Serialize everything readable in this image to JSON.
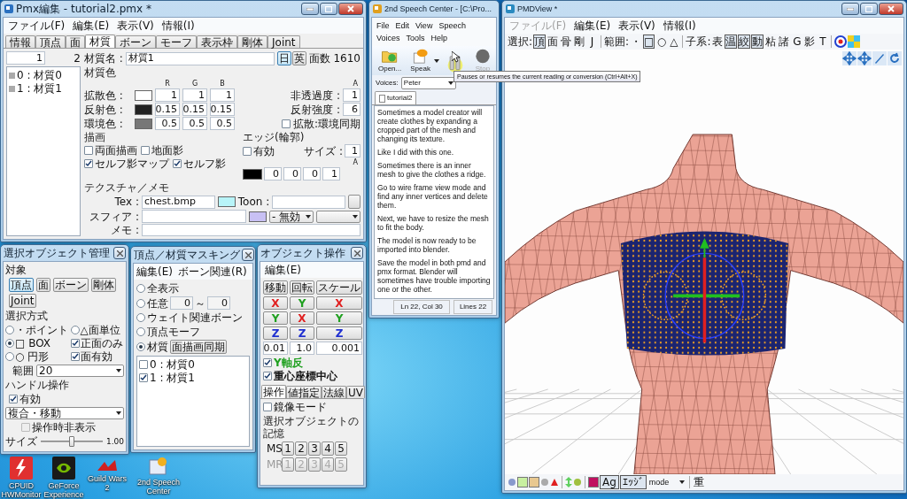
{
  "desktop": {
    "icons": [
      {
        "label": "CPUID HWMonitor",
        "kind": "cpuid"
      },
      {
        "label": "GeForce Experience",
        "kind": "geforce"
      },
      {
        "label": "Guild Wars 2",
        "kind": "game"
      },
      {
        "label": "2nd Speech Center",
        "kind": "speech"
      }
    ]
  },
  "pmx_editor": {
    "title": "Pmx編集 - tutorial2.pmx *",
    "menu": [
      "ファイル(F)",
      "編集(E)",
      "表示(V)",
      "情報(I)"
    ],
    "tabs": [
      {
        "label": "情報",
        "selected": false
      },
      {
        "label": "頂点",
        "selected": false
      },
      {
        "label": "面",
        "selected": false
      },
      {
        "label": "材質",
        "selected": true
      },
      {
        "label": "ボーン",
        "selected": false
      },
      {
        "label": "モーフ",
        "selected": false
      },
      {
        "label": "表示枠",
        "selected": false
      },
      {
        "label": "剛体",
        "selected": false
      },
      {
        "label": "Joint",
        "selected": false
      }
    ],
    "material_list": {
      "index": "1",
      "count": "2",
      "items": [
        "0 : 材質0",
        "1 : 材質1"
      ]
    },
    "name_label": "材質名 :",
    "name_value": "材質1",
    "lang_buttons": [
      {
        "label": "日",
        "selected": true
      },
      {
        "label": "英",
        "selected": false
      }
    ],
    "face_count_label": "面数",
    "face_count": "1610",
    "color_section": "材質色",
    "channel_headers": [
      "R",
      "G",
      "B"
    ],
    "alpha_header": "A",
    "color_rows": [
      {
        "label": "拡散色 :",
        "color": "#ffffff",
        "values": [
          "1",
          "1",
          "1"
        ],
        "side": {
          "kind": "field",
          "label": "非透過度 :",
          "value": "1"
        }
      },
      {
        "label": "反射色 :",
        "color": "#222222",
        "values": [
          "0.15",
          "0.15",
          "0.15"
        ],
        "side": {
          "kind": "field",
          "label": "反射強度 :",
          "value": "6"
        }
      },
      {
        "label": "環境色 :",
        "color": "#777777",
        "values": [
          "0.5",
          "0.5",
          "0.5"
        ],
        "side": {
          "kind": "checkbox",
          "label": "拡散:環境同期",
          "checked": false
        }
      }
    ],
    "draw_section": "描画",
    "draw_options": [
      {
        "label": "両面描画",
        "checked": false
      },
      {
        "label": "地面影",
        "checked": false
      },
      {
        "label": "セルフ影マップ",
        "checked": true
      },
      {
        "label": "セルフ影",
        "checked": true
      }
    ],
    "edge_section": "エッジ(輪郭)",
    "edge_enabled": {
      "label": "有効",
      "checked": false
    },
    "edge_size_label": "サイズ :",
    "edge_size": "1",
    "edge_alpha_header": "A",
    "edge_values": [
      "0",
      "0",
      "0",
      "1"
    ],
    "swatches": [
      {
        "kind": "edge",
        "color": "#000000"
      },
      {
        "kind": "texture",
        "color": "#b8f4f8"
      },
      {
        "kind": "sphere",
        "color": "#c8c0f4"
      }
    ],
    "texture_section": "テクスチャ／メモ",
    "tex_label": "Tex :",
    "tex_value": "chest.bmp",
    "toon_label": "Toon :",
    "sphere_label": "スフィア :",
    "sphere_mode": "- 無効",
    "memo_label": "メモ :"
  },
  "select_window": {
    "title": "選択オブジェクト管理",
    "target_label": "対象",
    "targets": [
      {
        "label": "頂点",
        "selected": true
      },
      {
        "label": "面",
        "selected": false
      },
      {
        "label": "ボーン",
        "selected": false
      },
      {
        "label": "剛体",
        "selected": false
      },
      {
        "label": "Joint",
        "selected": false
      }
    ],
    "method_label": "選択方式",
    "methods": [
      {
        "kind": "radio",
        "label": "・ポイント",
        "selected": false
      },
      {
        "kind": "radio",
        "label": "△面単位",
        "selected": false
      },
      {
        "kind": "radio",
        "label": "□ BOX",
        "selected": true
      },
      {
        "kind": "checkbox",
        "label": "正面のみ",
        "checked": true
      },
      {
        "kind": "radio",
        "label": "○ 円形",
        "selected": false
      },
      {
        "kind": "checkbox",
        "label": "面有効",
        "checked": true
      }
    ],
    "range_label": "範囲",
    "range_value": "20",
    "handle_label": "ハンドル操作",
    "handle_enabled": {
      "label": "有効",
      "checked": true
    },
    "handle_mode": "複合・移動",
    "hide_on_op": {
      "label": "操作時非表示",
      "checked": false
    },
    "size_label": "サイズ",
    "size_slider": {
      "level": 0.5
    },
    "size_value": "1.00"
  },
  "mask_window": {
    "title": "頂点／材質マスキング",
    "menu": [
      "編集(E)",
      "ボーン関連(R)"
    ],
    "modes": [
      {
        "kind": "plain",
        "label": "全表示",
        "selected": false
      },
      {
        "kind": "range",
        "label": "任意",
        "selected": false,
        "from": "0",
        "separator": "～",
        "to": "0"
      },
      {
        "kind": "plain",
        "label": "ウェイト関連ボーン",
        "selected": false
      },
      {
        "kind": "plain",
        "label": "頂点モーフ",
        "selected": false
      },
      {
        "kind": "button",
        "label": "材質",
        "selected": true,
        "button": "面描画同期"
      }
    ],
    "items": [
      {
        "label": "0 : 材質0",
        "checked": false
      },
      {
        "label": "1 : 材質1",
        "checked": true
      }
    ]
  },
  "object_window": {
    "title": "オブジェクト操作",
    "menu": [
      "編集(E)"
    ],
    "buttons": [
      "移動",
      "回転",
      "スケール"
    ],
    "axis_rows": [
      [
        {
          "label": "X",
          "color": "#e02020"
        },
        {
          "label": "Y",
          "color": "#20a020"
        },
        {
          "label": "X",
          "color": "#e02020"
        }
      ],
      [
        {
          "label": "Y",
          "color": "#20a020"
        },
        {
          "label": "X",
          "color": "#e02020"
        },
        {
          "label": "Y",
          "color": "#20a020"
        }
      ],
      [
        {
          "label": "Z",
          "color": "#2030d0"
        },
        {
          "label": "Z",
          "color": "#2030d0"
        },
        {
          "label": "Z",
          "color": "#2030d0"
        }
      ]
    ],
    "steps": [
      "0.01",
      "1.0",
      "0.001"
    ],
    "options": [
      {
        "label": "Y軸反",
        "checked": true,
        "color": "#20a020"
      },
      {
        "label": "重心座標中心",
        "checked": true,
        "color": "#111111"
      }
    ],
    "tabs": [
      {
        "label": "操作",
        "selected": true
      },
      {
        "label": "値指定",
        "selected": false
      },
      {
        "label": "法線",
        "selected": false
      },
      {
        "label": "UV",
        "selected": false
      }
    ],
    "mirror": {
      "label": "鏡像モード",
      "checked": false
    },
    "memory_label": "選択オブジェクトの記憶",
    "memory_rows": [
      {
        "label": "MS",
        "slots": [
          "1",
          "2",
          "3",
          "4",
          "5"
        ],
        "disabled": false
      },
      {
        "label": "MR",
        "slots": [
          "1",
          "2",
          "3",
          "4",
          "5"
        ],
        "disabled": true
      }
    ]
  },
  "speech_center": {
    "title": "2nd Speech Center - [C:\\Pro...",
    "menu": [
      "File",
      "Edit",
      "View",
      "Speech",
      "Voices",
      "Tools",
      "Help"
    ],
    "toolbar": [
      {
        "kind": "open",
        "label": "Open..."
      },
      {
        "kind": "speak",
        "label": "Speak"
      },
      {
        "kind": "pause"
      },
      {
        "kind": "stop",
        "label": "Stop"
      }
    ],
    "voices_label": "Voices:",
    "voice": "Peter",
    "document_tab": "tutorial2",
    "paragraphs": [
      "Sometimes a model creator will create clothes by expanding a cropped part of the mesh and changing its texture.",
      "Like I did with this one.",
      "Sometimes there is an inner mesh to give the clothes a ridge.",
      "Go to wire frame view mode and find any inner vertices and delete them.",
      "Next, we have to resize the mesh to fit the body.",
      "The model is now ready to be imported into blender.",
      "Save the model in both pmd and pmx format.  Blender will sometimes have trouble importing one or the other."
    ],
    "status": [
      "Ln 22, Col 30",
      "Lines 22"
    ]
  },
  "tooltip": "Pauses or resumes the current reading or conversion (Ctrl+Alt+X)",
  "pmd_view": {
    "title": "PMDView *",
    "menu": [
      {
        "label": "ファイル(F)",
        "disabled": true
      },
      {
        "label": "編集(E)",
        "disabled": false
      },
      {
        "label": "表示(V)",
        "disabled": false
      },
      {
        "label": "情報(I)",
        "disabled": false
      }
    ],
    "toolbar_groups": [
      {
        "label": "選択:",
        "buttons": [
          {
            "label": "頂",
            "selected": true
          },
          {
            "label": "面",
            "selected": false
          },
          {
            "label": "骨",
            "selected": false
          },
          {
            "label": "剛",
            "selected": false
          },
          {
            "label": "J",
            "selected": false
          }
        ]
      },
      {
        "label": "範囲:",
        "buttons": [
          {
            "label": "・",
            "selected": false
          },
          {
            "label": "□",
            "selected": true
          },
          {
            "label": "○",
            "selected": false
          },
          {
            "label": "△",
            "selected": false
          }
        ]
      },
      {
        "label": "子系:",
        "buttons": [
          {
            "label": "表",
            "selected": false
          },
          {
            "label": "温",
            "selected": true
          },
          {
            "label": "絞",
            "selected": true
          },
          {
            "label": "動",
            "selected": true
          },
          {
            "label": "粘",
            "selected": false
          },
          {
            "label": "諸",
            "selected": false
          },
          {
            "label": "G",
            "selected": false
          },
          {
            "label": "影",
            "selected": false
          },
          {
            "label": "T",
            "selected": false
          }
        ]
      }
    ],
    "bottom_toggles": [
      {
        "label": "Ag",
        "selected": true
      },
      {
        "label": "ｴｯｼﾞ",
        "selected": true
      }
    ],
    "mode": "mode",
    "mode_extra": "重"
  }
}
